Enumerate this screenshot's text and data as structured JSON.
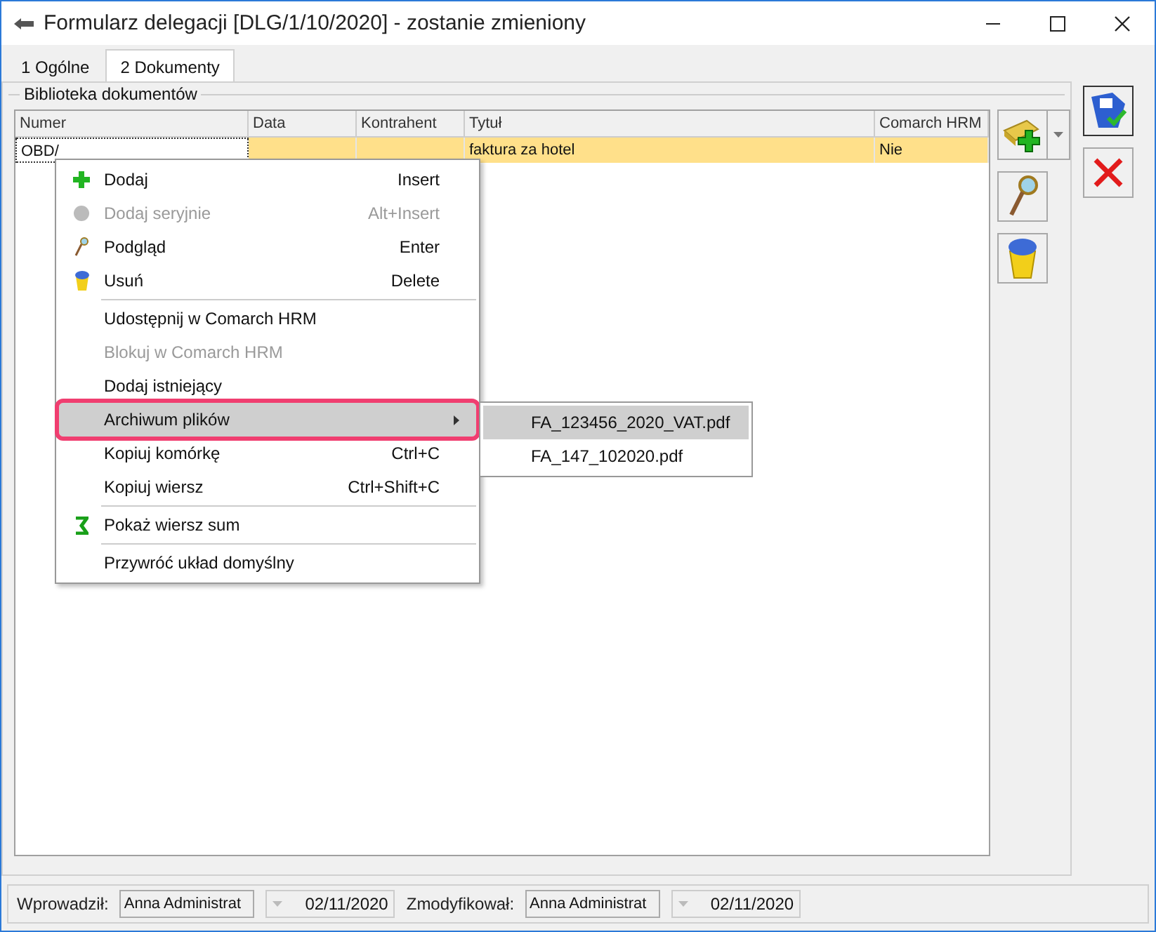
{
  "window": {
    "title": "Formularz delegacji [DLG/1/10/2020] - zostanie zmieniony"
  },
  "tabs": [
    {
      "label": "1 Ogólne",
      "selected": false
    },
    {
      "label": "2 Dokumenty",
      "selected": true
    }
  ],
  "group": {
    "title": "Biblioteka dokumentów"
  },
  "table": {
    "columns": [
      "Numer",
      "Data",
      "Kontrahent",
      "Tytuł",
      "Comarch HRM"
    ],
    "rows": [
      {
        "cells": [
          "OBD/",
          "",
          "",
          "faktura za hotel",
          "Nie"
        ],
        "selected": true
      }
    ]
  },
  "context_menu": {
    "items": [
      {
        "kind": "item",
        "label": "Dodaj",
        "shortcut": "Insert",
        "disabled": false,
        "highlighted": false
      },
      {
        "kind": "item",
        "label": "Dodaj seryjnie",
        "shortcut": "Alt+Insert",
        "disabled": true,
        "highlighted": false
      },
      {
        "kind": "item",
        "label": "Podgląd",
        "shortcut": "Enter",
        "disabled": false,
        "highlighted": false
      },
      {
        "kind": "item",
        "label": "Usuń",
        "shortcut": "Delete",
        "disabled": false,
        "highlighted": false
      },
      {
        "kind": "separator"
      },
      {
        "kind": "item",
        "label": "Udostępnij w Comarch HRM",
        "disabled": false,
        "highlighted": false
      },
      {
        "kind": "item",
        "label": "Blokuj w Comarch HRM",
        "disabled": true,
        "highlighted": false
      },
      {
        "kind": "item",
        "label": "Dodaj istniejący",
        "disabled": false,
        "highlighted": false
      },
      {
        "kind": "submenu",
        "label": "Archiwum plików",
        "disabled": false,
        "highlighted": true
      },
      {
        "kind": "item",
        "label": "Kopiuj komórkę",
        "shortcut": "Ctrl+C",
        "disabled": false,
        "highlighted": false
      },
      {
        "kind": "item",
        "label": "Kopiuj wiersz",
        "shortcut": "Ctrl+Shift+C",
        "disabled": false,
        "highlighted": false
      },
      {
        "kind": "separator"
      },
      {
        "kind": "item",
        "label": "Pokaż wiersz sum",
        "disabled": false,
        "highlighted": false
      },
      {
        "kind": "separator"
      },
      {
        "kind": "item",
        "label": "Przywróć układ domyślny",
        "disabled": false,
        "highlighted": false
      }
    ]
  },
  "submenu": {
    "items": [
      {
        "label": "FA_123456_2020_VAT.pdf",
        "selected": true
      },
      {
        "label": "FA_147_102020.pdf",
        "selected": false
      }
    ]
  },
  "footer": {
    "fields": [
      {
        "label": "Wprowadził:",
        "user": "Anna Administrat",
        "date": "02/11/2020"
      },
      {
        "label": "Zmodyfikował:",
        "user": "Anna Administrat",
        "date": "02/11/2020"
      }
    ]
  }
}
